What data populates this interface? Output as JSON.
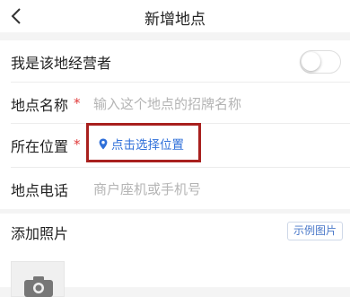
{
  "nav": {
    "title": "新增地点",
    "back_icon": "chevron-left-icon"
  },
  "operator_row": {
    "label": "我是该地经营者",
    "toggle_on": false
  },
  "name_row": {
    "label": "地点名称",
    "required_mark": "*",
    "placeholder": "输入这个地点的招牌名称"
  },
  "location_row": {
    "label": "所在位置",
    "required_mark": "*",
    "button_label": "点击选择位置",
    "button_icon": "location-pin-icon"
  },
  "phone_row": {
    "label": "地点电话",
    "placeholder": "商户座机或手机号"
  },
  "photos": {
    "label": "添加照片",
    "sample_button": "示例图片",
    "upload_icon": "camera-icon"
  },
  "colors": {
    "accent": "#2f6fd9",
    "required": "#e03a3a",
    "highlight_box": "#a8201e"
  }
}
